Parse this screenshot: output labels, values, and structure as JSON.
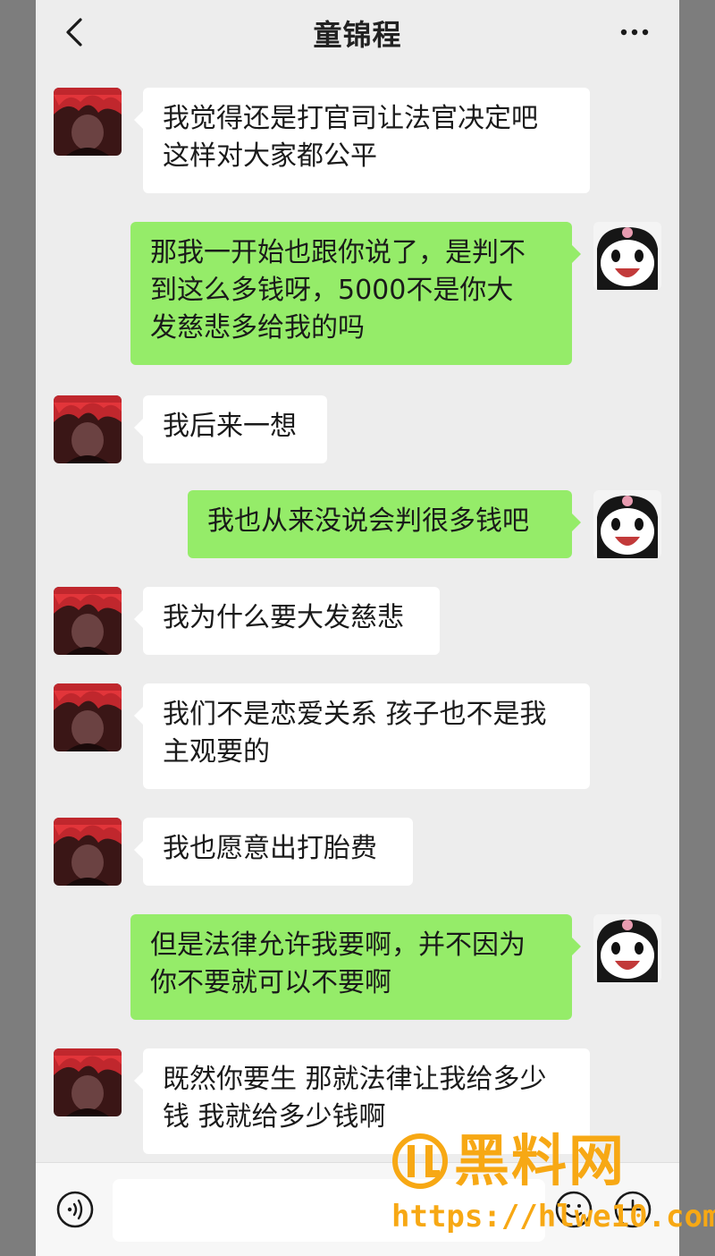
{
  "header": {
    "title": "童锦程"
  },
  "messages": [
    {
      "side": "left",
      "lines": [
        "我觉得还是打官司让法官决定吧",
        "这样对大家都公平"
      ]
    },
    {
      "side": "right",
      "lines": [
        "那我一开始也跟你说了，是判不",
        "到这么多钱呀，5000不是你大",
        "发慈悲多给我的吗"
      ]
    },
    {
      "side": "left",
      "lines": [
        "我后来一想"
      ]
    },
    {
      "side": "right",
      "lines": [
        "我也从来没说会判很多钱吧"
      ]
    },
    {
      "side": "left",
      "lines": [
        "我为什么要大发慈悲"
      ]
    },
    {
      "side": "left",
      "lines": [
        "我们不是恋爱关系 孩子也不是我",
        "主观要的"
      ]
    },
    {
      "side": "left",
      "lines": [
        "我也愿意出打胎费"
      ]
    },
    {
      "side": "right",
      "lines": [
        "但是法律允许我要啊，并不因为",
        "你不要就可以不要啊"
      ]
    },
    {
      "side": "left",
      "lines": [
        "既然你要生 那就法律让我给多少",
        "钱 我就给多少钱啊"
      ]
    }
  ],
  "input": {
    "value": ""
  },
  "watermark": {
    "name": "黑料网",
    "url": "https://hlwe10.com"
  },
  "colors": {
    "outgoing_bubble": "#95ec69",
    "incoming_bubble": "#ffffff",
    "background": "#ededed",
    "watermark": "#f7a814"
  }
}
